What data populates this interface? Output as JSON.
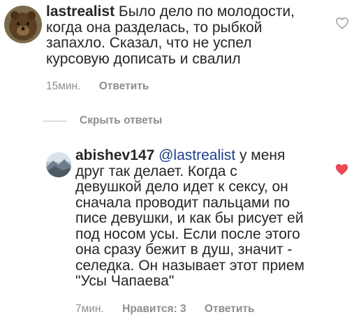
{
  "comments": [
    {
      "username": "lastrealist",
      "text_lines": [
        "Было дело по молодости,",
        "когда она разделась, то рыбкой",
        "запахло. Сказал, что не успел",
        "курсовую дописать и свалил"
      ],
      "time": "15мин.",
      "reply_label": "Ответить",
      "liked": false
    },
    {
      "username": "abishev147",
      "mention": "@lastrealist",
      "first_line_rest": "у меня",
      "text_lines": [
        "друг так делает. Когда с",
        "девушкой дело идет к сексу, он",
        "сначала проводит пальцами по",
        "писе девушки, и как бы рисует ей",
        "под носом усы. Если после этого",
        "она сразу бежит в душ, значит -",
        "селедка. Он называет этот прием",
        "\"Усы Чапаева\""
      ],
      "time": "7мин.",
      "likes_label": "Нравится: 3",
      "reply_label": "Ответить",
      "liked": true
    }
  ],
  "hide_replies_label": "Скрыть ответы",
  "colors": {
    "heart_liked": "#ed4956",
    "heart_outline": "#9a9a9a",
    "meta_gray": "#8e8e8e"
  },
  "icons": {
    "like": "heart-icon"
  }
}
